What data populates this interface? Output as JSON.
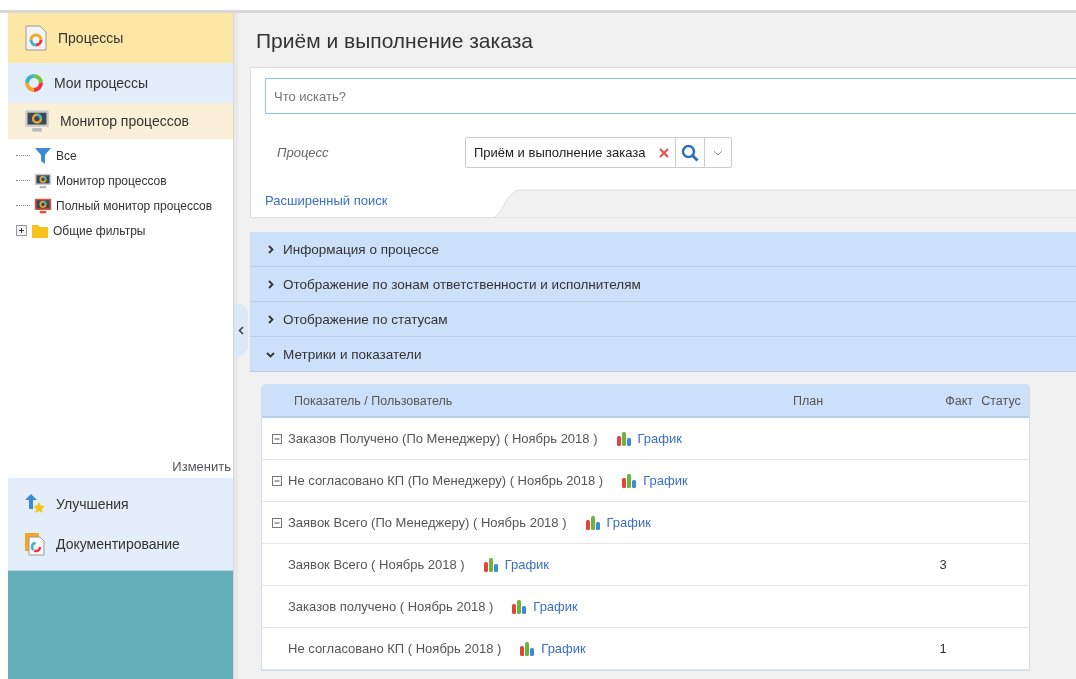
{
  "sidebar": {
    "nav": [
      {
        "label": "Процессы",
        "kind": "header",
        "selected": false
      },
      {
        "label": "Мои процессы",
        "kind": "ring",
        "selected": false
      },
      {
        "label": "Монитор процессов",
        "kind": "monitor",
        "selected": true
      }
    ],
    "tree": [
      {
        "label": "Все",
        "kind": "filter"
      },
      {
        "label": "Монитор процессов",
        "kind": "monitor"
      },
      {
        "label": "Полный монитор процессов",
        "kind": "monitor-red"
      },
      {
        "label": "Общие фильтры",
        "kind": "folder",
        "expanded": false
      }
    ],
    "edit_link": "Изменить",
    "bottom_nav": [
      {
        "label": "Улучшения",
        "kind": "improve"
      },
      {
        "label": "Документирование",
        "kind": "doc"
      }
    ]
  },
  "page_title": "Приём и выполнение заказа",
  "search": {
    "placeholder": "Что искать?",
    "process_label": "Процесс",
    "process_value": "Приём и выполнение заказа",
    "advanced_link": "Расширенный поиск"
  },
  "sections": [
    {
      "title": "Информация о процессе",
      "expanded": false
    },
    {
      "title": "Отображение по зонам ответственности и исполнителям",
      "expanded": false
    },
    {
      "title": "Отображение по статусам",
      "expanded": false
    },
    {
      "title": "Метрики и показатели",
      "expanded": true
    }
  ],
  "table": {
    "columns": [
      "Показатель / Пользователь",
      "План",
      "Факт",
      "Статус"
    ],
    "rows": [
      {
        "kind": "group",
        "expanded": true,
        "name": "Заказов Получено (По Менеджеру) ( Ноябрь 2018 )",
        "link": "График"
      },
      {
        "kind": "group",
        "expanded": true,
        "name": "Не согласовано КП (По Менеджеру) ( Ноябрь 2018 )",
        "link": "График"
      },
      {
        "kind": "group",
        "expanded": true,
        "name": "Заявок Всего (По Менеджеру) ( Ноябрь 2018 )",
        "link": "График"
      },
      {
        "kind": "item",
        "name": "Заявок Всего ( Ноябрь 2018 )",
        "link": "График",
        "fact": "3"
      },
      {
        "kind": "item",
        "name": "Заказов получено ( Ноябрь 2018 )",
        "link": "График"
      },
      {
        "kind": "item",
        "name": "Не согласовано КП ( Ноябрь 2018 )",
        "link": "График",
        "fact": "1"
      }
    ]
  }
}
